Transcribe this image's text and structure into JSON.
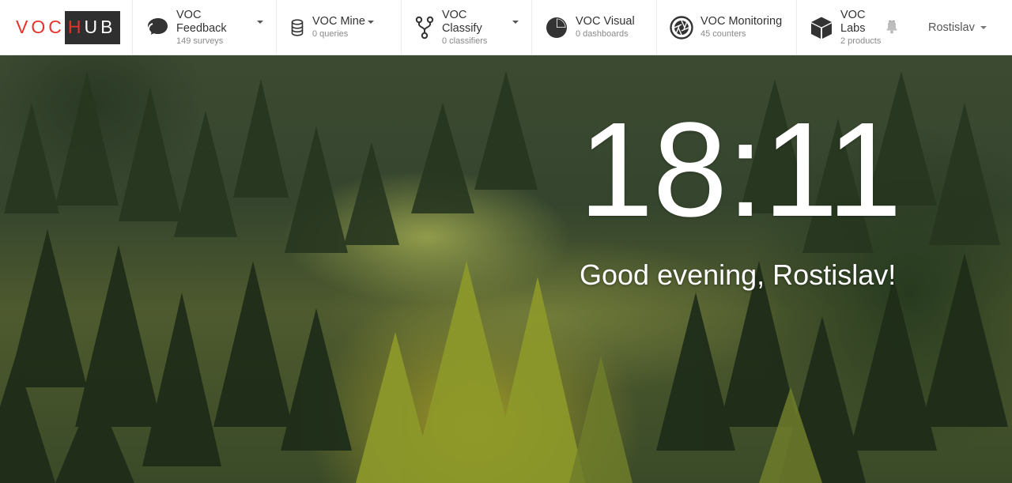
{
  "app": {
    "logo_voc": "VOC",
    "logo_h": "H",
    "logo_ub": "UB"
  },
  "nav": [
    {
      "title": "VOC Feedback",
      "sub": "149 surveys",
      "icon": "chat-bubble-icon",
      "has_menu": true
    },
    {
      "title": "VOC Mine",
      "sub": "0 queries",
      "icon": "database-icon",
      "has_menu": true
    },
    {
      "title": "VOC Classify",
      "sub": "0 classifiers",
      "icon": "fork-icon",
      "has_menu": true
    },
    {
      "title": "VOC Visual",
      "sub": "0 dashboards",
      "icon": "pie-chart-icon",
      "has_menu": false
    },
    {
      "title": "VOC Monitoring",
      "sub": "45 counters",
      "icon": "aperture-icon",
      "has_menu": false
    },
    {
      "title": "VOC Labs",
      "sub": "2 products",
      "icon": "cube-icon",
      "has_menu": true
    }
  ],
  "user": {
    "name": "Rostislav"
  },
  "hero": {
    "time": "18:11",
    "greeting": "Good evening, Rostislav!"
  },
  "colors": {
    "brand_red": "#e8322d",
    "logo_dark": "#2f2f2f"
  }
}
